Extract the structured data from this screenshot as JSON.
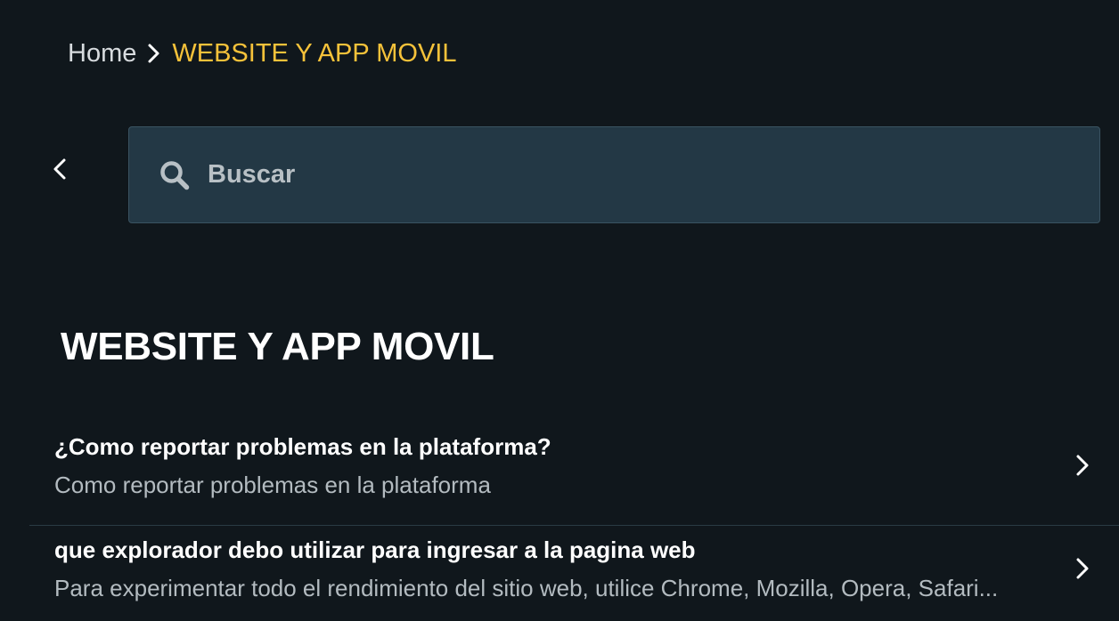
{
  "breadcrumb": {
    "home": "Home",
    "current": "WEBSITE Y APP MOVIL"
  },
  "search": {
    "placeholder": "Buscar",
    "value": ""
  },
  "section": {
    "title": "WEBSITE Y APP MOVIL"
  },
  "articles": [
    {
      "title": "¿Como reportar problemas en la plataforma?",
      "description": "Como reportar problemas en la plataforma"
    },
    {
      "title": "que explorador debo utilizar para ingresar a la pagina web",
      "description": "Para experimentar todo el rendimiento del sitio web, utilice Chrome, Mozilla, Opera, Safari..."
    }
  ],
  "icons": {
    "breadcrumb_separator": "chevron-right-icon",
    "back": "chevron-left-icon",
    "search": "search-icon",
    "article_arrow": "chevron-right-icon"
  },
  "colors": {
    "background": "#10171c",
    "accent": "#f6c23a",
    "search_background": "#233845",
    "divider": "#2a3b44"
  }
}
